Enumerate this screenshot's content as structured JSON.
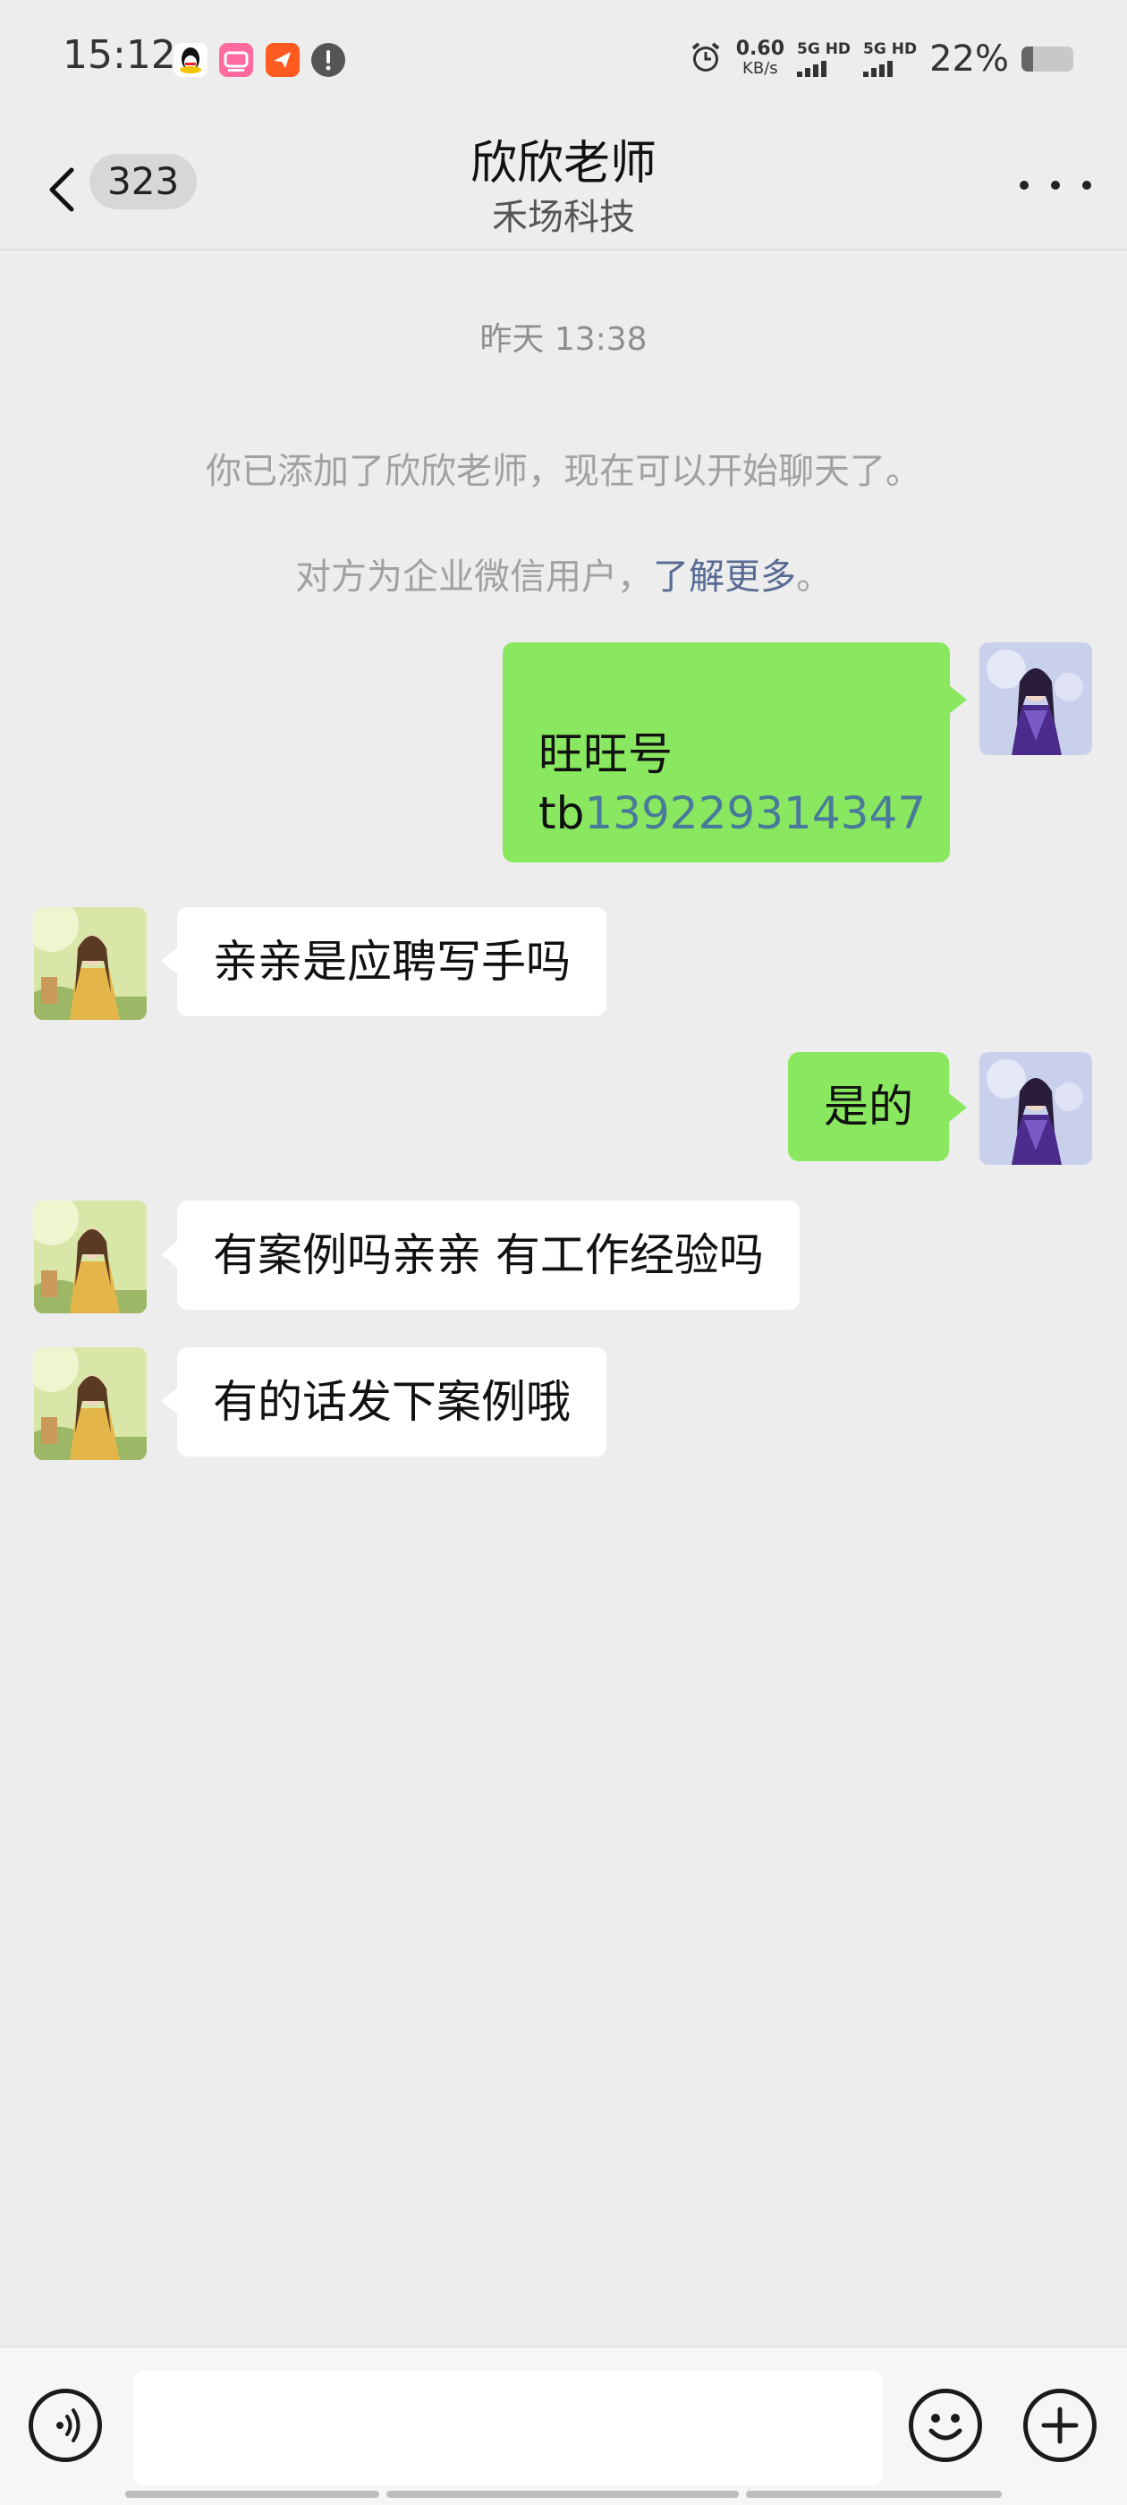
{
  "status_bar": {
    "time": "15:12",
    "net_speed": "0.60",
    "net_unit": "KB/s",
    "sim1": "5G HD",
    "sim2": "5G HD",
    "battery": "22%",
    "battery_level": 0.22,
    "notification_icons": [
      "qq-icon",
      "bilibili-icon",
      "red-app-icon",
      "alert-icon"
    ]
  },
  "nav": {
    "back_count": "323",
    "title": "欣欣老师",
    "subtitle": "禾场科技"
  },
  "chat": {
    "timestamp": "昨天 13:38",
    "system_line1": "你已添加了欣欣老师，现在可以开始聊天了。",
    "system_line2_prefix": "对方为企业微信用户，",
    "system_line2_link": "了解更多",
    "system_line2_suffix": "。",
    "messages": [
      {
        "sender": "me",
        "line1": "旺旺号",
        "line2_prefix": "tb",
        "line2_link": "139229314347"
      },
      {
        "sender": "other",
        "text": "亲亲是应聘写手吗"
      },
      {
        "sender": "me",
        "text": "是的"
      },
      {
        "sender": "other",
        "text": "有案例吗亲亲 有工作经验吗"
      },
      {
        "sender": "other",
        "text": "有的话发下案例哦"
      }
    ]
  },
  "input_bar": {
    "voice_icon": "voice-icon",
    "emoji_icon": "emoji-icon",
    "plus_icon": "plus-icon",
    "message_value": ""
  },
  "colors": {
    "background": "#ededed",
    "my_bubble": "#89e85f",
    "other_bubble": "#ffffff",
    "link": "#576b95"
  }
}
